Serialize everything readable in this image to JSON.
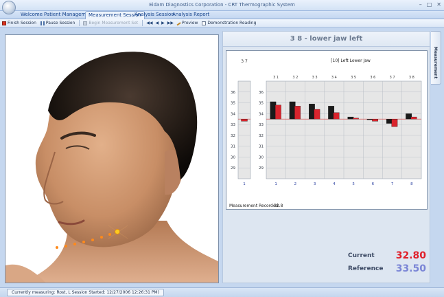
{
  "window": {
    "title": "Eidam Diagnostics Corporation - CRT Thermographic System"
  },
  "tabs": [
    {
      "label": "Welcome"
    },
    {
      "label": "Patient Management"
    },
    {
      "label": "Measurement Session",
      "active": true
    },
    {
      "label": "Analysis Session"
    },
    {
      "label": "Analysis Report"
    }
  ],
  "toolbar": {
    "finish_session": "Finish Session",
    "pause_session": "Pause Session",
    "begin_measurement_set": "Begin Measurement Set",
    "preview": "Preview",
    "demonstration_reading": "Demonstration Reading"
  },
  "side_tab": {
    "label": "Measurement"
  },
  "panel": {
    "title": "3 8 - lower jaw left"
  },
  "measurement_recorded": {
    "label": "Measurement Recorded:",
    "value": "32.8"
  },
  "readouts": {
    "current_label": "Current",
    "current_value": "32.80",
    "reference_label": "Reference",
    "reference_value": "33.50",
    "current_color": "#e0202a",
    "reference_color": "#7b86d6"
  },
  "status": {
    "text": "Currently measuring:  Rost, L  Session Started: 12/27/2006 12:26:31 PM)"
  },
  "chart_data": [
    {
      "type": "bar",
      "title": "",
      "column_label": "3 7",
      "categories": [
        "1"
      ],
      "series": [
        {
          "values": [
            33.3
          ],
          "color": "#d9242d"
        }
      ],
      "ylim": [
        28,
        37
      ],
      "yticks": [
        29,
        30,
        31,
        32,
        33,
        34,
        35,
        36
      ],
      "reference_line": 33.5
    },
    {
      "type": "bar",
      "title": "[10] Left Lower Jaw",
      "column_labels": [
        "3 1",
        "3 2",
        "3 3",
        "3 4",
        "3 5",
        "3 6",
        "3 7",
        "3 8"
      ],
      "categories": [
        "1",
        "2",
        "3",
        "4",
        "5",
        "6",
        "7",
        "8"
      ],
      "series": [
        {
          "values": [
            35.1,
            35.1,
            34.9,
            34.7,
            33.7,
            33.5,
            33.1,
            34.0
          ],
          "color": "#1a1a1a"
        },
        {
          "values": [
            34.8,
            34.7,
            34.4,
            34.1,
            33.6,
            33.3,
            32.8,
            33.7
          ],
          "color": "#d9242d"
        }
      ],
      "ylim": [
        28,
        37
      ],
      "yticks": [
        29,
        30,
        31,
        32,
        33,
        34,
        35,
        36
      ],
      "reference_line": 33.5
    }
  ]
}
